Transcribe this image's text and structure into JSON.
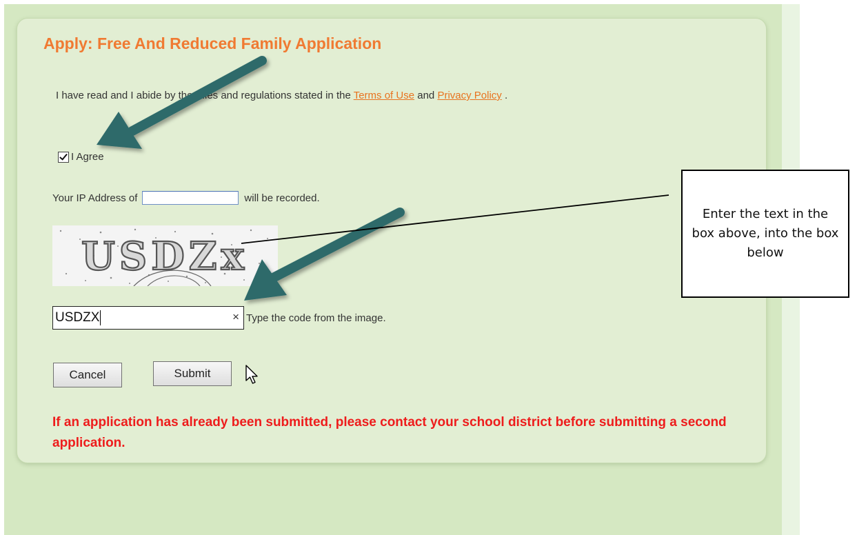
{
  "form": {
    "title": "Apply: Free And Reduced Family Application",
    "terms_prefix": "I have read and I abide by the rules and regulations stated in the ",
    "terms_link": "Terms of Use",
    "terms_and": " and ",
    "privacy_link": "Privacy Policy",
    "terms_suffix": " .",
    "agree_label": "I Agree",
    "agree_checked": true,
    "ip_prefix": "Your IP Address of",
    "ip_value": "",
    "ip_suffix": "will be recorded.",
    "captcha_text": "USDZx",
    "code_value": "USDZX",
    "code_clear": "×",
    "code_hint": "Type the code from the image.",
    "cancel_label": "Cancel",
    "submit_label": "Submit",
    "warning": "If an application has already been submitted, please contact your school district before submitting a second application."
  },
  "annotation": {
    "callout_text": "Enter the text in the box above, into the box below"
  },
  "colors": {
    "title": "#f07a32",
    "link": "#e8731f",
    "warning": "#ee1c1c",
    "arrow": "#2f6b6a",
    "panel_bg": "#e2eed3"
  }
}
